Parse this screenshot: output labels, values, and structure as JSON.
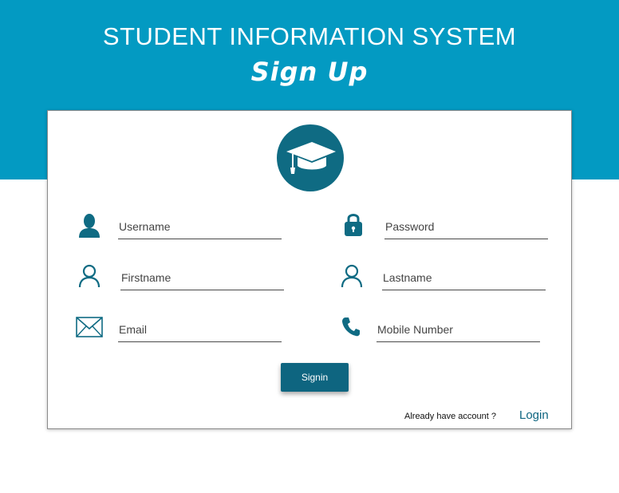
{
  "header": {
    "app_title": "STUDENT INFORMATION SYSTEM",
    "page_heading": "Sign Up",
    "background_color": "#039ac2"
  },
  "logo": {
    "icon": "graduation-cap-icon",
    "color": "#0f6b83"
  },
  "form": {
    "username": {
      "placeholder": "Username",
      "value": "",
      "icon": "user-solid-icon"
    },
    "password": {
      "placeholder": "Password",
      "value": "",
      "icon": "lock-icon"
    },
    "firstname": {
      "placeholder": "Firstname",
      "value": "",
      "icon": "user-outline-icon"
    },
    "lastname": {
      "placeholder": "Lastname",
      "value": "",
      "icon": "user-outline-icon"
    },
    "email": {
      "placeholder": "Email",
      "value": "",
      "icon": "envelope-icon"
    },
    "mobile": {
      "placeholder": "Mobile Number",
      "value": "",
      "icon": "phone-icon"
    }
  },
  "actions": {
    "signin_label": "Signin",
    "already_text": "Already have account ?",
    "login_label": "Login"
  },
  "accent_color": "#0e6580"
}
